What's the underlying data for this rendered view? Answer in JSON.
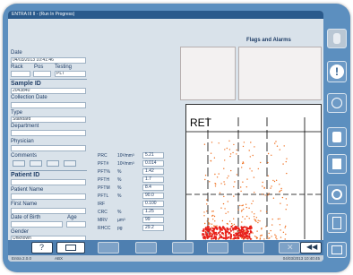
{
  "title_bar": "ENTRA III II - (Run In Progress)",
  "left_panel": {
    "date_label": "Date",
    "date_value": "04/03/2013 10:41:46",
    "rack_label": "Rack",
    "pos_label": "Pos",
    "testing_label": "Testing",
    "testing_value": "PLT",
    "sample_id_label": "Sample ID",
    "sample_id_value": "2043840",
    "collection_date_label": "Collection Date",
    "type_label": "Type",
    "type_value": "Standard",
    "department_label": "Department",
    "physician_label": "Physician",
    "comments_label": "Comments",
    "patient_id_label": "Patient ID",
    "patient_name_label": "Patient Name",
    "first_name_label": "First Name",
    "dob_label": "Date of Birth",
    "age_label": "Age",
    "gender_label": "Gender",
    "gender_value": "Unknown"
  },
  "measurements": [
    {
      "name": "PRC",
      "unit": "10³/mm³",
      "value": "5.21"
    },
    {
      "name": "PFT#",
      "unit": "10³/mm³",
      "value": "0.014"
    },
    {
      "name": "PFT%",
      "unit": "%",
      "value": "1.42"
    },
    {
      "name": "PFTH",
      "unit": "%",
      "value": "1.7"
    },
    {
      "name": "PFTM",
      "unit": "%",
      "value": "8.4"
    },
    {
      "name": "PFTL",
      "unit": "%",
      "value": "90.0"
    },
    {
      "name": "IRF",
      "unit": "",
      "value": "0.100"
    },
    {
      "name": "CRC",
      "unit": "%",
      "value": "1.25"
    },
    {
      "name": "MRV",
      "unit": "µm³",
      "value": "99"
    },
    {
      "name": "RHCC",
      "unit": "pg",
      "value": "29.2"
    }
  ],
  "flags_title": "Flags and Alarms",
  "plot_label": "RET",
  "status_bar": {
    "version": "Entra 2.0.0",
    "user": "ABX",
    "datetime": "04/03/2013 10:40:45"
  },
  "colors": {
    "device": "#5c8fbf",
    "screen": "#d9e2ea",
    "scatter": "#f07020",
    "scatter_dense": "#e8201a"
  },
  "toolbar_icons": [
    "help-icon",
    "print-icon",
    "archive-icon",
    "results-icon",
    "calibration-icon",
    "reagent-icon",
    "edit-icon",
    "cancel-icon",
    "back-icon"
  ],
  "side_icons": [
    "hand-icon",
    "alert-icon",
    "qc-icon",
    "flask-icon",
    "report-icon",
    "cycle-icon",
    "tools-icon",
    "rack-icon"
  ]
}
